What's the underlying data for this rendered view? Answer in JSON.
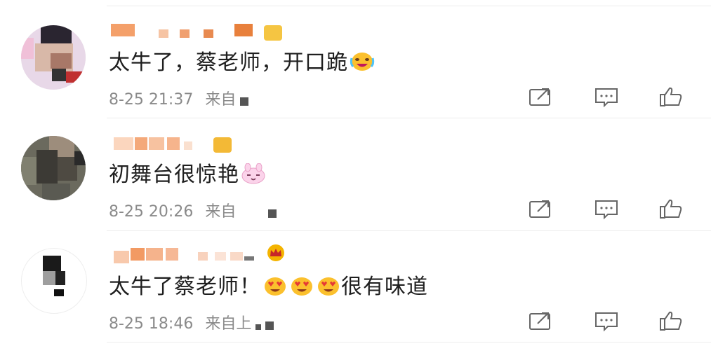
{
  "comments": [
    {
      "text": "太牛了，蔡老师，开口跪",
      "emoji": "laugh-cry-emoji",
      "time": "8-25 21:37",
      "source": "来自"
    },
    {
      "text": "初舞台很惊艳",
      "emoji": "bunny-emoji",
      "time": "8-25 20:26",
      "source": "来自"
    },
    {
      "text": "太牛了蔡老师！",
      "emoji": "heart-eyes-emoji",
      "suffix": "很有味道",
      "time": "8-25 18:46",
      "source": "来自上"
    }
  ],
  "icons": {
    "share": "share-icon",
    "comment": "comment-icon",
    "like": "thumbs-up-icon"
  },
  "colors": {
    "text": "#1f1f1f",
    "meta": "#8a8a8a",
    "icon": "#666666",
    "badge": "#f5b41f",
    "blur_orange": "#f29a63"
  }
}
